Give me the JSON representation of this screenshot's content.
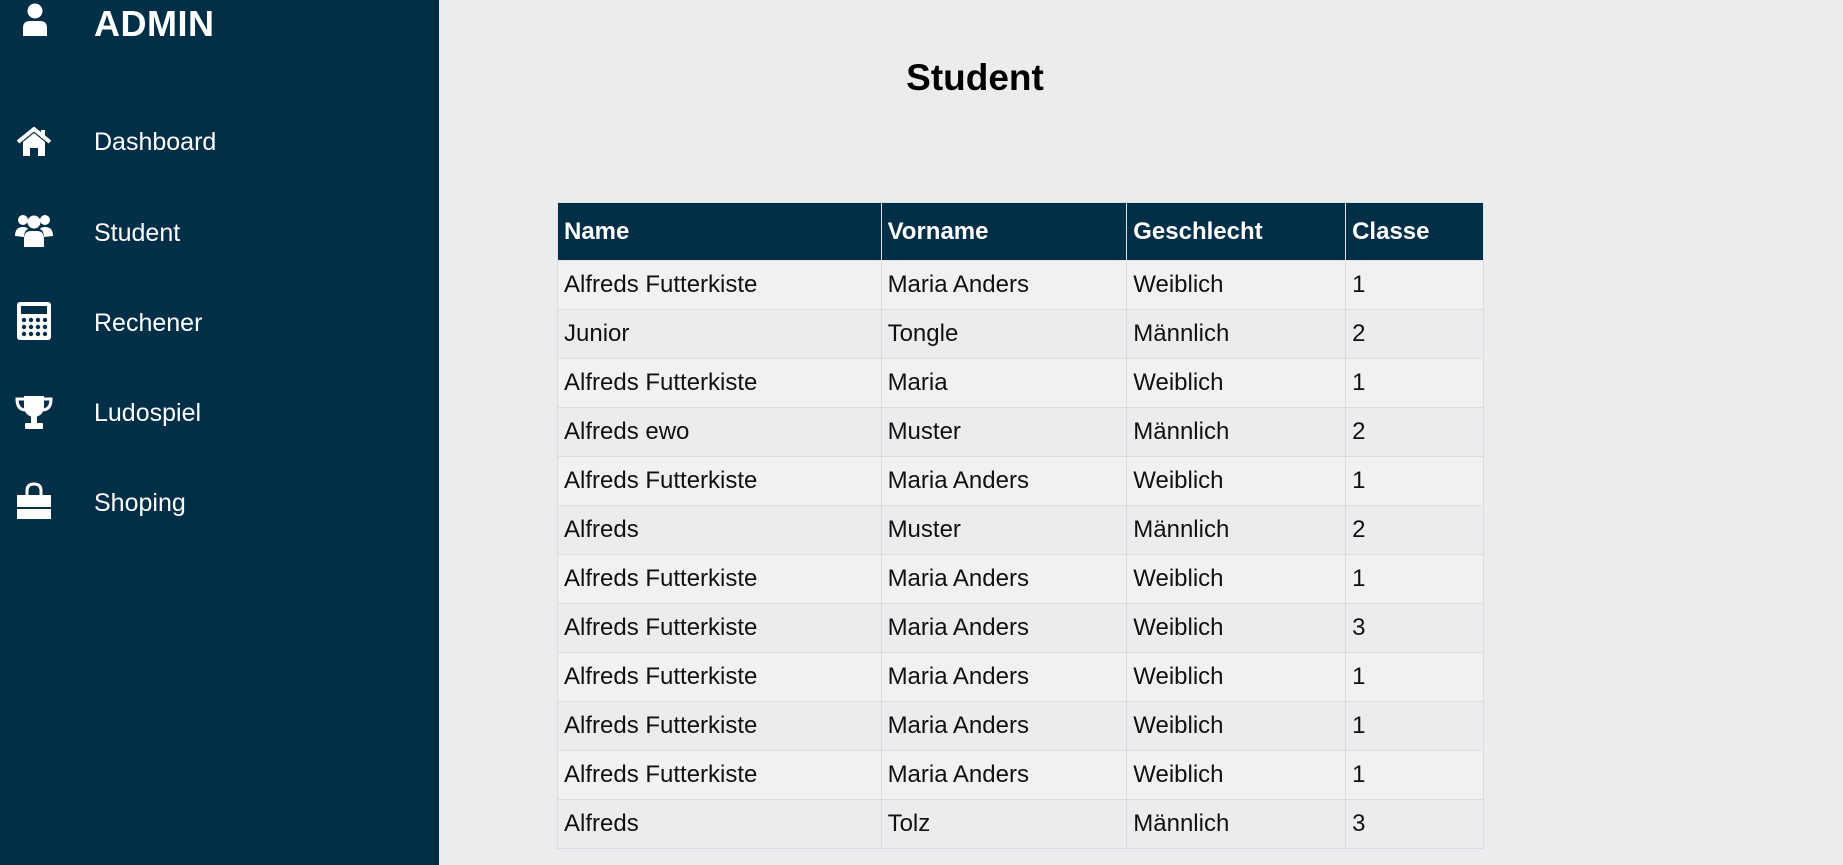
{
  "sidebar": {
    "brand": {
      "title": "ADMIN",
      "icon": "user-icon"
    },
    "items": [
      {
        "label": "Dashboard",
        "icon": "home-icon"
      },
      {
        "label": "Student",
        "icon": "users-icon"
      },
      {
        "label": "Rechener",
        "icon": "calculator-icon"
      },
      {
        "label": "Ludospiel",
        "icon": "trophy-icon"
      },
      {
        "label": "Shoping",
        "icon": "shopping-bag-icon"
      }
    ]
  },
  "main": {
    "title": "Student",
    "table": {
      "headers": [
        "Name",
        "Vorname",
        "Geschlecht",
        "Classe"
      ],
      "rows": [
        [
          "Alfreds Futterkiste",
          "Maria Anders",
          "Weiblich",
          "1"
        ],
        [
          "Junior",
          "Tongle",
          "Männlich",
          "2"
        ],
        [
          "Alfreds Futterkiste",
          "Maria",
          "Weiblich",
          "1"
        ],
        [
          "Alfreds ewo",
          "Muster",
          "Männlich",
          "2"
        ],
        [
          "Alfreds Futterkiste",
          "Maria Anders",
          "Weiblich",
          "1"
        ],
        [
          "Alfreds",
          "Muster",
          "Männlich",
          "2"
        ],
        [
          "Alfreds Futterkiste",
          "Maria Anders",
          "Weiblich",
          "1"
        ],
        [
          "Alfreds Futterkiste",
          "Maria Anders",
          "Weiblich",
          "3"
        ],
        [
          "Alfreds Futterkiste",
          "Maria Anders",
          "Weiblich",
          "1"
        ],
        [
          "Alfreds Futterkiste",
          "Maria Anders",
          "Weiblich",
          "1"
        ],
        [
          "Alfreds Futterkiste",
          "Maria Anders",
          "Weiblich",
          "1"
        ],
        [
          "Alfreds",
          "Tolz",
          "Männlich",
          "3"
        ]
      ]
    }
  },
  "colors": {
    "sidebar_bg": "#012f47",
    "page_bg": "#ebecee",
    "table_header_bg": "#012f47",
    "row_odd_bg": "#f1f1f1",
    "row_even_bg": "#ebecee"
  }
}
